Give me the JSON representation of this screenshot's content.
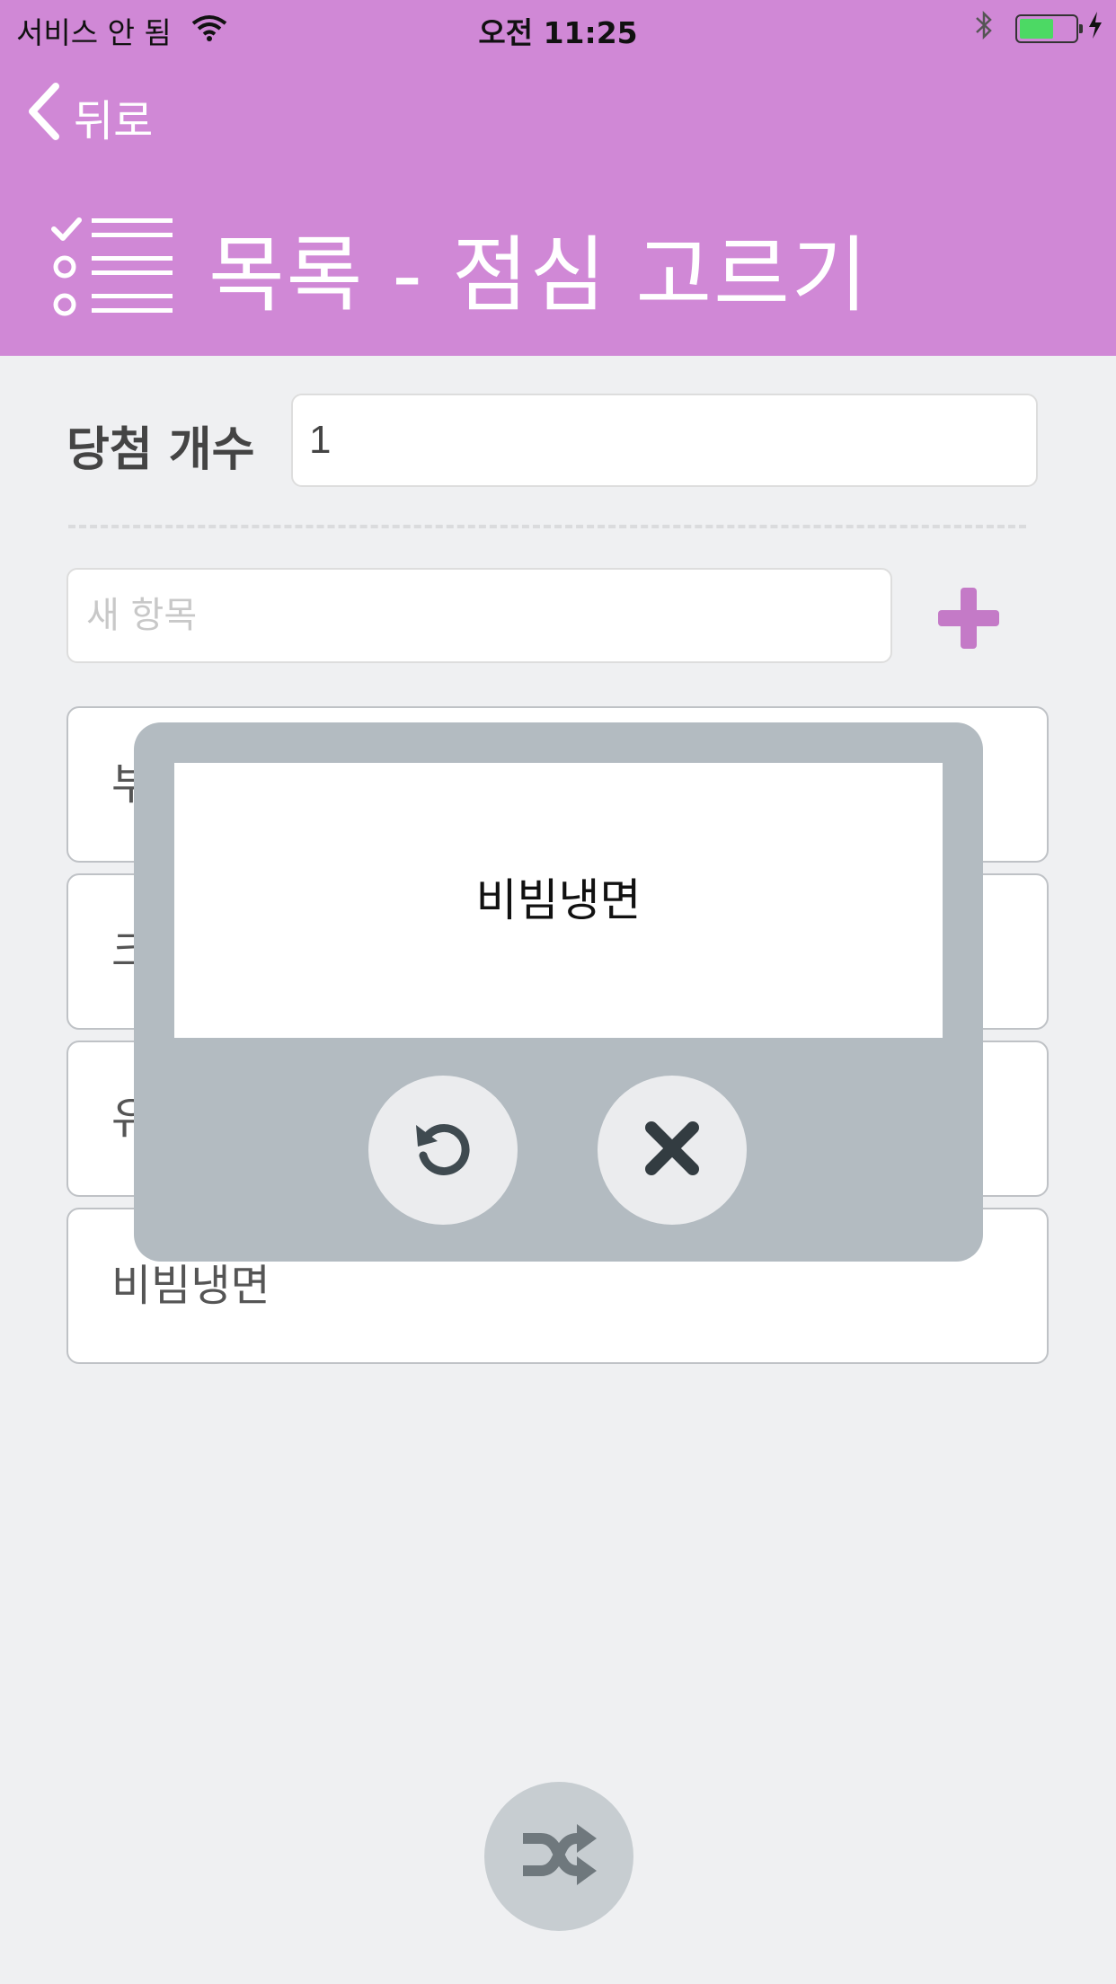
{
  "status_bar": {
    "carrier": "서비스 안 됨",
    "time": "오전 11:25",
    "battery_level": 0.6,
    "battery_color": "#4cd964"
  },
  "header": {
    "back_label": "뒤로",
    "title": "목록 - 점심 고르기",
    "icon": "checklist-icon",
    "background": "#d088d6"
  },
  "winners": {
    "label": "당첨 개수",
    "value": "1"
  },
  "new_item": {
    "placeholder": "새 항목",
    "add_icon": "plus-icon",
    "accent": "#c47ac7"
  },
  "items": [
    {
      "label": "부"
    },
    {
      "label": "크"
    },
    {
      "label": "유"
    },
    {
      "label": "비빔냉면"
    }
  ],
  "modal": {
    "result": "비빔냉면",
    "retry_icon": "refresh-icon",
    "close_icon": "close-icon"
  },
  "shuffle_icon": "shuffle-icon"
}
